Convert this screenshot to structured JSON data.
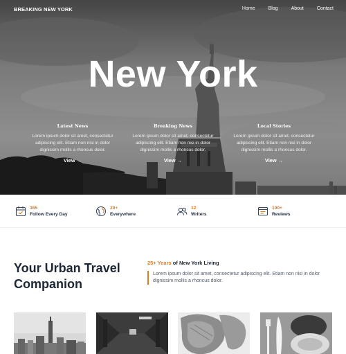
{
  "header": {
    "brand": "BREAKING NEW YORK",
    "nav": [
      "Home",
      "Blog",
      "About",
      "Contact"
    ]
  },
  "hero": {
    "title": "New York",
    "features": [
      {
        "title": "Latest News",
        "text": "Lorem ipsum dolor sit amet, consectetur adipiscing elit. Etiam non nisi in dolor dignissim mollis a rhoncus dolor.",
        "link": "View →"
      },
      {
        "title": "Breaking News",
        "text": "Lorem ipsum dolor sit amet, consectetur adipiscing elit. Etiam non nisi in dolor dignissim mollis a rhoncus dolor.",
        "link": "View →"
      },
      {
        "title": "Local Stories",
        "text": "Lorem ipsum dolor sit amet, consectetur adipiscing elit. Etiam non nisi in dolor dignissim mollis a rhoncus dolor.",
        "link": "View →"
      }
    ]
  },
  "stats": [
    {
      "value": "365",
      "label": "Follow Every Day",
      "icon": "calendar-icon"
    },
    {
      "value": "20+",
      "label": "Everywhere",
      "icon": "globe-icon"
    },
    {
      "value": "12",
      "label": "Writers",
      "icon": "users-icon"
    },
    {
      "value": "100+",
      "label": "Reviews",
      "icon": "browser-window-icon"
    }
  ],
  "about": {
    "title_line1": "Your Urban Travel",
    "title_line2": "Companion",
    "years_accent": "25+ Years",
    "years_rest": "of New York Living",
    "description": "Lorem ipsum dolor sit amet, consectetur adipiscing elit. Etiam non nisi in dolor dignissim mollis a rhoncus dolor."
  },
  "gallery": [
    "skyline-photo",
    "subway-photo",
    "bagel-bread-photo",
    "food-plate-photo"
  ],
  "colors": {
    "accent": "#e07a1e",
    "heading": "#1d2634",
    "icon": "#39465a"
  }
}
